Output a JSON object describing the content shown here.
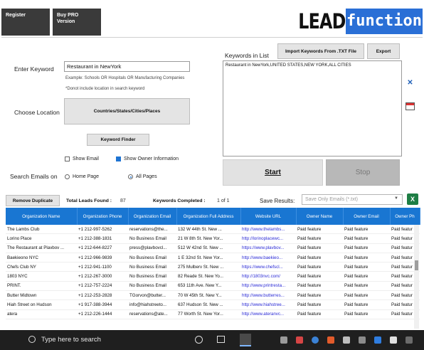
{
  "header": {
    "register_label": "Register",
    "buy_pro_label": "Buy PRO Version",
    "logo_left": "LEAD",
    "logo_right": "function"
  },
  "form": {
    "keyword_label": "Enter Keyword",
    "keyword_value": "Restaurant in NewYork",
    "example_text": "Example: Schools OR Hospitals OR Manufacturing Companies",
    "location_note": "*Donot include location in search keyword",
    "location_label": "Choose Location",
    "location_button": "Countries/States/Cities/Places",
    "keyword_finder_button": "Keyword Finder",
    "show_email_label": "Show Email",
    "show_email_checked": false,
    "show_owner_label": "Show Owner Information",
    "show_owner_checked": true,
    "search_emails_label": "Search Emails on",
    "home_page_label": "Home Page",
    "all_pages_label": "All Pages",
    "selected_scope": "All Pages"
  },
  "keywords_panel": {
    "label": "Keywords in List",
    "import_button": "Import Keywords From .TXT File",
    "export_button": "Export",
    "list_text": "Restaurant in NewYork,UNITED STATES,NEW YORK,ALL CITIES",
    "start_button": "Start",
    "stop_button": "Stop"
  },
  "status": {
    "remove_duplicate_button": "Remove Duplicate",
    "total_leads_label": "Total Leads Found :",
    "total_leads_value": "87",
    "keywords_completed_label": "Keywords Completed :",
    "keywords_completed_value": "1 of 1",
    "save_results_label": "Save Results:",
    "save_results_value": "Save Only Emails (*.txt)"
  },
  "table": {
    "columns": [
      "Organization Name",
      "Organization Phone",
      "Organization Email",
      "Organization Full Address",
      "Website URL",
      "Owner Name",
      "Owner Email",
      "Owner Ph"
    ],
    "rows": [
      [
        "The Lambs Club",
        "+1 212-997-5262",
        "reservations@the...",
        "132 W 44th St. New ...",
        "http://www.thelambs...",
        "Paid feature",
        "Paid feature",
        "Paid featur"
      ],
      [
        "Lorino Place",
        "+1 212-388-1831",
        "No Business Email",
        "21 W 8th St. New Yor...",
        "http://lorinoplacewc...",
        "Paid feature",
        "Paid feature",
        "Paid featur"
      ],
      [
        "The Restaurant at Plavbov ...",
        "+1 212-644-8227",
        "press@plavbovcl...",
        "512 W 42nd St. New ...",
        "https://www.plavbov...",
        "Paid feature",
        "Paid feature",
        "Paid featur"
      ],
      [
        "Baekieono NYC",
        "+1 212-966-9839",
        "No Business Email",
        "1 E 32nd St. New Yor...",
        "http://www.baekieo...",
        "Paid feature",
        "Paid feature",
        "Paid featur"
      ],
      [
        "Chefs Club NY",
        "+1 212-941-1100",
        "No Business Email",
        "275 Mulberv St. New ...",
        "https://www.chefscl...",
        "Paid feature",
        "Paid feature",
        "Paid featur"
      ],
      [
        "1803 NYC",
        "+1 212-267-3000",
        "No Business Email",
        "82 Reade St. New Yo...",
        "http://1803nvc.com/",
        "Paid feature",
        "Paid feature",
        "Paid featur"
      ],
      [
        "PRINT.",
        "+1 212-757-2224",
        "No Business Email",
        "653 11th Ave. New Y...",
        "http://www.printresta...",
        "Paid feature",
        "Paid feature",
        "Paid featur"
      ],
      [
        "Butter Midtown",
        "+1 212-253-2828",
        "TGorvon@butter...",
        "70 W 45th St. New Y...",
        "http://www.butterres...",
        "Paid feature",
        "Paid feature",
        "Paid featur"
      ],
      [
        "Hiah Street on Hudson",
        "+1 917-388-3944",
        "info@hiahstreeto...",
        "637 Hudson St. New ...",
        "http://www.hiahstree...",
        "Paid feature",
        "Paid feature",
        "Paid featur"
      ],
      [
        "atera",
        "+1 212-226-1444",
        "reservations@ate...",
        "77 Worth St. New Yor...",
        "http://www.ateranvc...",
        "Paid feature",
        "Paid feature",
        "Paid featur"
      ]
    ]
  },
  "taskbar": {
    "search_placeholder": "Type here to search"
  },
  "colors": {
    "header_blue": "#1976d2",
    "start_bg": "#e2e2e2",
    "stop_bg": "#b8b8b8",
    "logo_blue": "#2a6fd6"
  }
}
